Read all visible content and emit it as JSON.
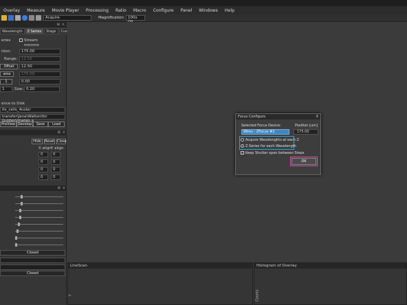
{
  "menu": [
    "Overlay",
    "Measure",
    "Movie Player",
    "Processing",
    "Ratio",
    "Macro",
    "Configure",
    "Panel",
    "Windows",
    "Help"
  ],
  "toolbar": {
    "acquire_label": "Acquire",
    "magnification_label": "Magnification",
    "magnification_value": "100x Oil"
  },
  "left_tabs": [
    "Wavelength",
    "Z Series",
    "Stage",
    "Custom"
  ],
  "zseries": {
    "series_label": "eries",
    "stream_label": "Stream",
    "microns_label": "microns",
    "position_label": "ition:",
    "position_value": "175.00",
    "range_label": "Range:",
    "range_value": "12.50",
    "offset_label": "Offset",
    "offset_value": "12.50",
    "same_label": "ame",
    "same_value": "175.00",
    "top_offset_label": "Offset",
    "top_offset_value": "0.00",
    "size_label": "Size:",
    "size_value": "0.20",
    "step_value": "1"
  },
  "save": {
    "disk_label": "ence to Disk",
    "file1": "0x_cells_4color",
    "file2": "transfer\\Jana\\Walton\\for Guides\\images a",
    "buttons": [
      "PreView",
      "Develop",
      "Save",
      "Load"
    ]
  },
  "align": {
    "buttons": [
      "Hide",
      "Reset",
      "Close"
    ],
    "xalign": "X align",
    "yalign": "Y align",
    "values": [
      "0",
      "0",
      "0",
      "0",
      "0",
      "0",
      "0",
      "0"
    ]
  },
  "closed": [
    "Closed",
    "Closed"
  ],
  "dialog": {
    "title": "Focus Configure",
    "close": "X",
    "selected_device_label": "Selected Focus Device:",
    "position_label": "Position [um]",
    "device_value": "Wires - ZFocus #2",
    "position_value": "175.00",
    "radio1": "Acquire Wavelengths at each Z",
    "radio2": "Z Series for each Wavelength",
    "keep_shutter": "Keep Shutter open between Steps",
    "ok": "OK"
  },
  "bottom": {
    "linescan": "LineScan",
    "hist": "Histogram of Overlay",
    "y_axis": "Y",
    "counts": "Counts"
  }
}
